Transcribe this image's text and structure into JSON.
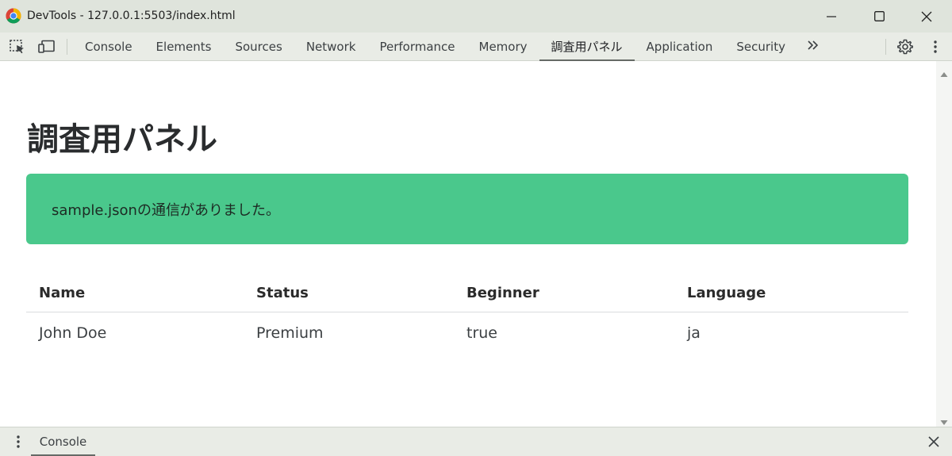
{
  "window": {
    "title": "DevTools - 127.0.0.1:5503/index.html",
    "logo_icon": "chrome-logo-icon",
    "controls": [
      "minimize-icon",
      "maximize-icon",
      "close-icon"
    ]
  },
  "toolbar": {
    "left_icons": [
      "inspect-element-icon",
      "device-toolbar-icon"
    ],
    "tabs": [
      {
        "label": "Console"
      },
      {
        "label": "Elements"
      },
      {
        "label": "Sources"
      },
      {
        "label": "Network"
      },
      {
        "label": "Performance"
      },
      {
        "label": "Memory"
      },
      {
        "label": "調査用パネル",
        "active": true
      },
      {
        "label": "Application"
      },
      {
        "label": "Security"
      }
    ],
    "more_tabs_icon": "double-chevron-right-icon",
    "right_icons": [
      "gear-icon",
      "kebab-menu-icon"
    ]
  },
  "page": {
    "heading": "調査用パネル",
    "notice": "sample.jsonの通信がありました。",
    "notice_color": "#4ac88c",
    "table": {
      "headers": [
        "Name",
        "Status",
        "Beginner",
        "Language"
      ],
      "rows": [
        [
          "John Doe",
          "Premium",
          "true",
          "ja"
        ]
      ]
    }
  },
  "drawer": {
    "menu_icon": "kebab-menu-icon",
    "tab_label": "Console",
    "close_icon": "close-icon"
  }
}
